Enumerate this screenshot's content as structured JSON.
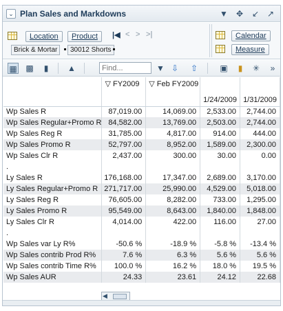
{
  "window": {
    "title": "Plan Sales and Markdowns"
  },
  "pivot": {
    "row_dims": [
      "Location",
      "Product"
    ],
    "col_dims": [
      "Calendar",
      "Measure"
    ],
    "filters": [
      "Brick & Mortar",
      "30012 Shorts"
    ]
  },
  "toolbar": {
    "find_placeholder": "Find..."
  },
  "grid": {
    "columns": [
      {
        "top": "▽ FY2009",
        "bottom": ""
      },
      {
        "top": "▽ Feb FY2009",
        "bottom": ""
      },
      {
        "top": "",
        "bottom": "1/24/2009"
      },
      {
        "top": "",
        "bottom": "1/31/2009"
      }
    ],
    "rows": [
      {
        "label": "Wp Sales R",
        "values": [
          "87,019.00",
          "14,069.00",
          "2,533.00",
          "2,744.00"
        ]
      },
      {
        "label": "Wp Sales Regular+Promo R",
        "values": [
          "84,582.00",
          "13,769.00",
          "2,503.00",
          "2,744.00"
        ]
      },
      {
        "label": "Wp Sales Reg R",
        "values": [
          "31,785.00",
          "4,817.00",
          "914.00",
          "444.00"
        ]
      },
      {
        "label": "Wp Sales Promo R",
        "values": [
          "52,797.00",
          "8,952.00",
          "1,589.00",
          "2,300.00"
        ]
      },
      {
        "label": "Wp Sales Clr R",
        "values": [
          "2,437.00",
          "300.00",
          "30.00",
          "0.00"
        ]
      },
      {
        "label": ".",
        "values": [
          "",
          "",
          "",
          ""
        ]
      },
      {
        "label": "Ly Sales R",
        "values": [
          "176,168.00",
          "17,347.00",
          "2,689.00",
          "3,170.00"
        ]
      },
      {
        "label": "Ly Sales Regular+Promo R",
        "values": [
          "271,717.00",
          "25,990.00",
          "4,529.00",
          "5,018.00"
        ]
      },
      {
        "label": "Ly Sales Reg R",
        "values": [
          "76,605.00",
          "8,282.00",
          "733.00",
          "1,295.00"
        ]
      },
      {
        "label": "Ly Sales Promo R",
        "values": [
          "95,549.00",
          "8,643.00",
          "1,840.00",
          "1,848.00"
        ]
      },
      {
        "label": "Ly Sales Clr R",
        "values": [
          "4,014.00",
          "422.00",
          "116.00",
          "27.00"
        ]
      },
      {
        "label": ".",
        "values": [
          "",
          "",
          "",
          ""
        ]
      },
      {
        "label": "Wp Sales var Ly R%",
        "values": [
          "-50.6 %",
          "-18.9 %",
          "-5.8 %",
          "-13.4 %"
        ]
      },
      {
        "label": "Wp Sales contrib Prod R%",
        "values": [
          "7.6 %",
          "6.3 %",
          "5.6 %",
          "5.6 %"
        ]
      },
      {
        "label": "Wp Sales contrib Time R%",
        "values": [
          "100.0 %",
          "16.2 %",
          "18.0 %",
          "19.5 %"
        ]
      },
      {
        "label": "Wp Sales AUR",
        "values": [
          "24.33",
          "23.61",
          "24.12",
          "22.68"
        ]
      }
    ]
  },
  "colors": {
    "accent": "#1d3b59",
    "row_shade": "#e9ebee",
    "border": "#b7c3cf"
  }
}
